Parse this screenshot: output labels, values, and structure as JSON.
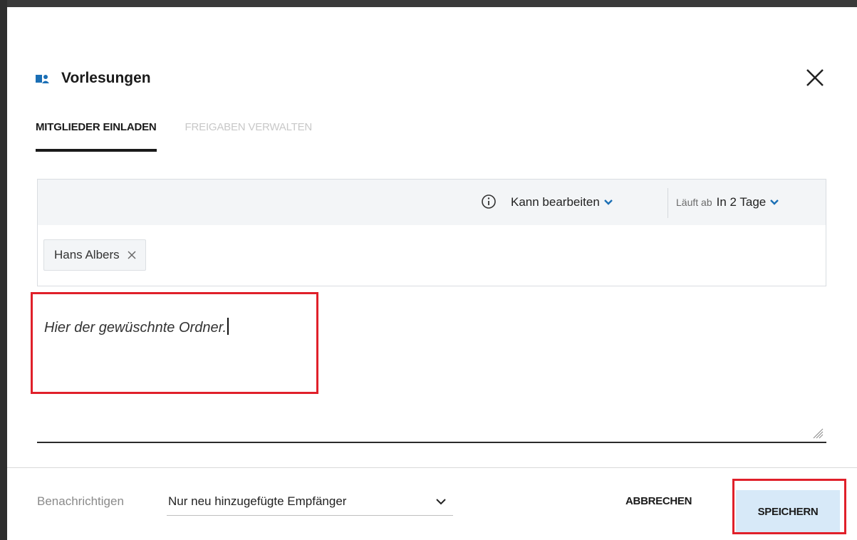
{
  "dialog": {
    "title": "Vorlesungen",
    "icon": "shared-folder-icon",
    "close_icon": "close-icon"
  },
  "tabs": [
    {
      "label": "MITGLIEDER EINLADEN",
      "active": true
    },
    {
      "label": "FREIGABEN VERWALTEN",
      "active": false
    }
  ],
  "permissions": {
    "info_icon": "info-icon",
    "role": "Kann bearbeiten",
    "expiry_label": "Läuft ab",
    "expiry_value": "In 2 Tage"
  },
  "recipients": [
    {
      "name": "Hans Albers"
    }
  ],
  "message": {
    "value": "Hier der gewüschnte Ordner."
  },
  "footer": {
    "notify_label": "Benachrichtigen",
    "notify_value": "Nur neu hinzugefügte Empfänger",
    "cancel_label": "ABBRECHEN",
    "save_label": "SPEICHERN"
  },
  "colors": {
    "accent": "#1b6fb5",
    "highlight": "#e0202a",
    "save_bg": "#d7e9f8"
  }
}
